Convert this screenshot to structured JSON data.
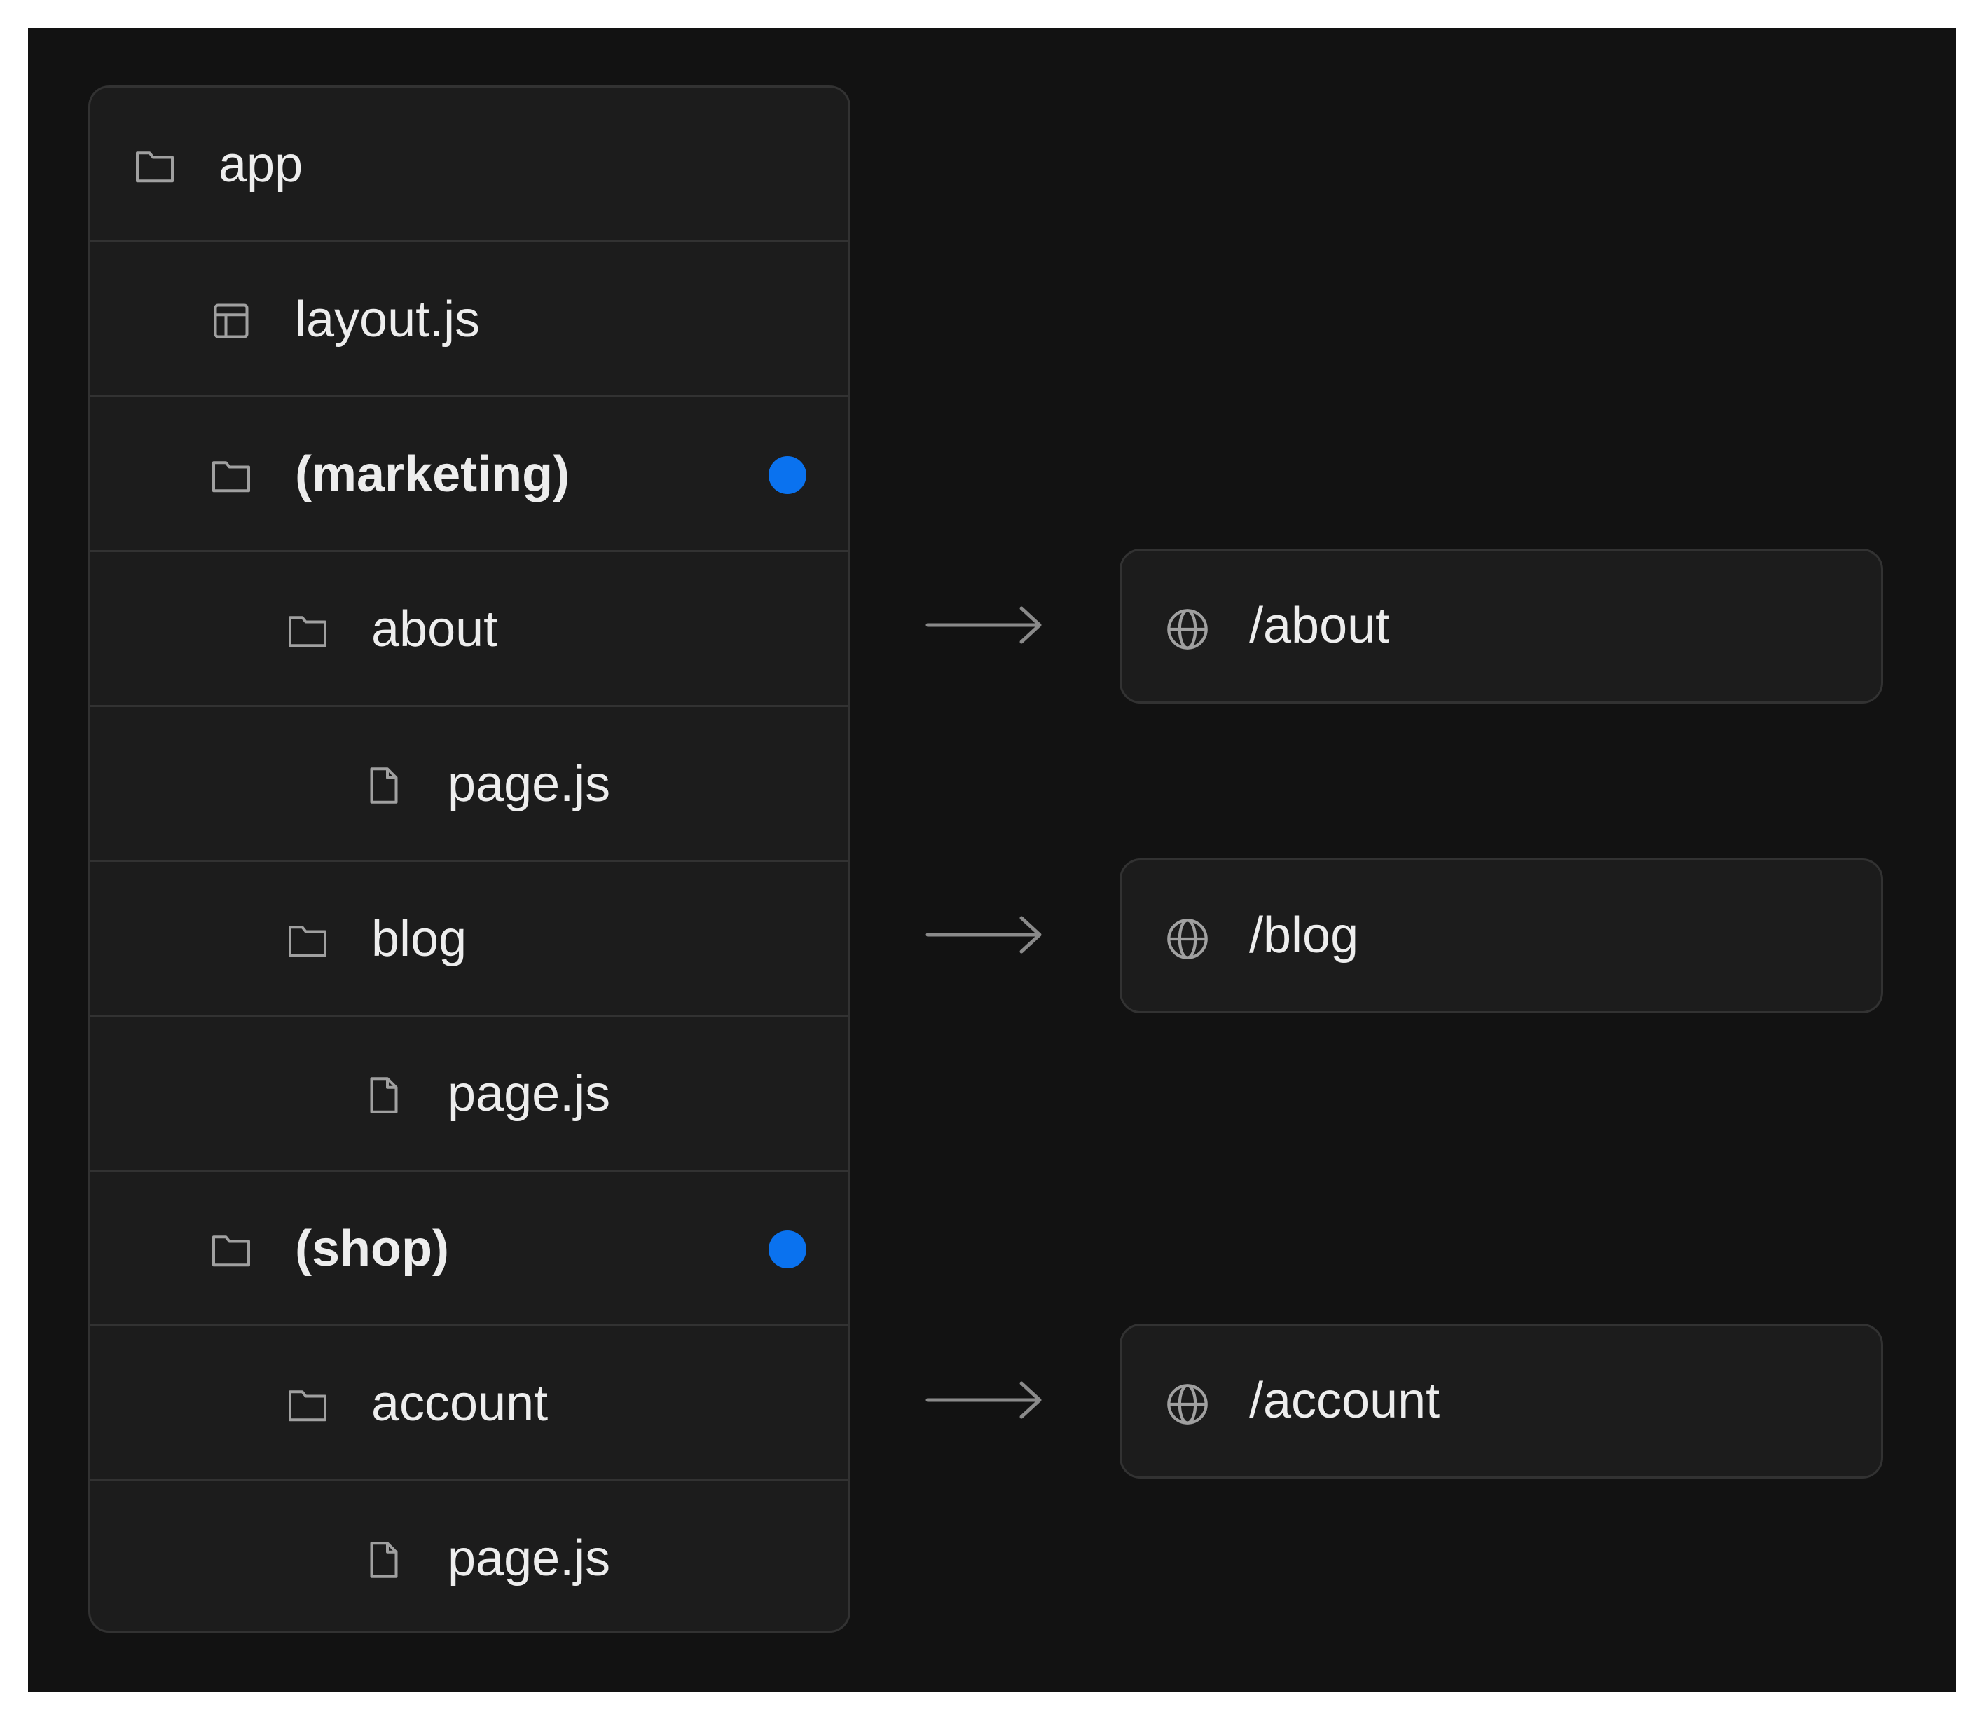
{
  "tree": {
    "rows": [
      {
        "label": "app",
        "icon": "folder-icon",
        "bold": false,
        "group": false
      },
      {
        "label": "layout.js",
        "icon": "layout-icon",
        "bold": false,
        "group": false
      },
      {
        "label": "(marketing)",
        "icon": "folder-icon",
        "bold": true,
        "group": true
      },
      {
        "label": "about",
        "icon": "folder-icon",
        "bold": false,
        "group": false
      },
      {
        "label": "page.js",
        "icon": "file-icon",
        "bold": false,
        "group": false
      },
      {
        "label": "blog",
        "icon": "folder-icon",
        "bold": false,
        "group": false
      },
      {
        "label": "page.js",
        "icon": "file-icon",
        "bold": false,
        "group": false
      },
      {
        "label": "(shop)",
        "icon": "folder-icon",
        "bold": true,
        "group": true
      },
      {
        "label": "account",
        "icon": "folder-icon",
        "bold": false,
        "group": false
      },
      {
        "label": "page.js",
        "icon": "file-icon",
        "bold": false,
        "group": false
      }
    ]
  },
  "routes": [
    {
      "label": "/about",
      "icon": "globe-icon"
    },
    {
      "label": "/blog",
      "icon": "globe-icon"
    },
    {
      "label": "/account",
      "icon": "globe-icon"
    }
  ],
  "colors": {
    "background": "#121212",
    "panel": "#1c1c1c",
    "border": "#323232",
    "text": "#ededed",
    "icon": "#a0a0a0",
    "group_marker": "#0a72ef"
  }
}
